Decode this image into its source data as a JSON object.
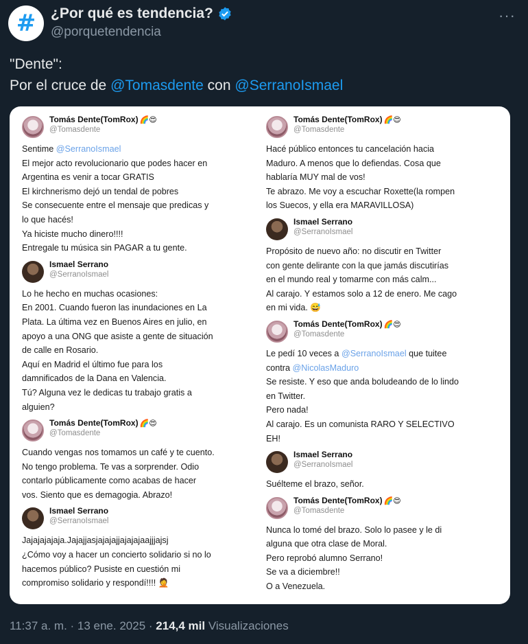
{
  "account": {
    "name": "¿Por qué es tendencia?",
    "handle": "@porquetendencia",
    "avatar_glyph": "#",
    "verified_color": "#1d9bf0"
  },
  "more_label": "···",
  "tweet": {
    "line1": "\"Dente\":",
    "line2_prefix": "Por el cruce de",
    "mention1": "@Tomasdente",
    "line2_mid": "con",
    "mention2": "@SerranoIsmael"
  },
  "embed": {
    "left": [
      {
        "author": "Tomás Dente(TomRox)",
        "emoji": "🌈😍",
        "handle": "@Tomasdente",
        "lines": [
          {
            "pre": "Sentime ",
            "mention": "@SerranoIsmael",
            "post": ""
          },
          {
            "pre": "El mejor acto revolucionario que podes hacer en"
          },
          {
            "pre": "Argentina es venir a tocar GRATIS"
          },
          {
            "pre": "El kirchnerismo dejó un tendal de pobres"
          },
          {
            "pre": "Se consecuente entre el mensaje que predicas y"
          },
          {
            "pre": "lo que hacés!"
          },
          {
            "pre": "Ya hiciste mucho dinero!!!!"
          },
          {
            "pre": "Entregale tu música sin PAGAR a tu gente."
          }
        ]
      },
      {
        "author": "Ismael Serrano",
        "emoji": "",
        "handle": "@SerranoIsmael",
        "lines": [
          {
            "pre": "Lo he hecho en muchas ocasiones:"
          },
          {
            "pre": "En 2001. Cuando fueron las inundaciones en La"
          },
          {
            "pre": "Plata. La última vez en Buenos Aires en julio, en"
          },
          {
            "pre": "apoyo a una ONG que asiste a gente de situación"
          },
          {
            "pre": "de calle en Rosario."
          },
          {
            "pre": "Aquí en Madrid el último fue para los"
          },
          {
            "pre": "damnificados de la Dana en Valencia."
          },
          {
            "pre": "Tú? Alguna vez le dedicas tu trabajo gratis a"
          },
          {
            "pre": "alguien?"
          }
        ]
      },
      {
        "author": "Tomás Dente(TomRox)",
        "emoji": "🌈😍",
        "handle": "@Tomasdente",
        "lines": [
          {
            "pre": "Cuando vengas nos tomamos un café y te cuento."
          },
          {
            "pre": "No tengo problema. Te vas a sorprender. Odio"
          },
          {
            "pre": "contarlo públicamente como acabas de hacer"
          },
          {
            "pre": "vos. Siento que es demagogia. Abrazo!"
          }
        ]
      },
      {
        "author": "Ismael Serrano",
        "emoji": "",
        "handle": "@SerranoIsmael",
        "lines": [
          {
            "pre": "Jajajajajaja.Jajajjasjajajajjajajajaajjjajsj"
          },
          {
            "pre": "¿Cómo voy a hacer un concierto solidario si no lo"
          },
          {
            "pre": "hacemos público? Pusiste en cuestión mi"
          },
          {
            "pre": "compromiso solidario y respondí!!!! 🤦"
          }
        ]
      }
    ],
    "right": [
      {
        "author": "Tomás Dente(TomRox)",
        "emoji": "🌈😍",
        "handle": "@Tomasdente",
        "lines": [
          {
            "pre": "Hacé público entonces tu cancelación hacia"
          },
          {
            "pre": "Maduro. A menos que lo defiendas. Cosa que"
          },
          {
            "pre": "hablaría MUY mal de vos!"
          },
          {
            "pre": "Te abrazo. Me voy a escuchar Roxette(la rompen"
          },
          {
            "pre": "los Suecos, y ella era MARAVILLOSA)"
          }
        ]
      },
      {
        "author": "Ismael Serrano",
        "emoji": "",
        "handle": "@SerranoIsmael",
        "lines": [
          {
            "pre": "Propósito de nuevo año: no discutir en Twitter"
          },
          {
            "pre": "con gente delirante con la que jamás discutirías"
          },
          {
            "pre": "en el mundo real y tomarme con más calm..."
          },
          {
            "pre": "Al carajo. Y estamos solo a 12 de enero. Me cago"
          },
          {
            "pre": "en mi vida. 😅"
          }
        ]
      },
      {
        "author": "Tomás Dente(TomRox)",
        "emoji": "🌈😍",
        "handle": "@Tomasdente",
        "lines": [
          {
            "pre": "Le pedí 10 veces a ",
            "mention": "@SerranoIsmael",
            "post": " que tuitee"
          },
          {
            "pre": "contra ",
            "mention": "@NicolasMaduro",
            "post": ""
          },
          {
            "pre": "Se resiste. Y eso que anda boludeando de lo lindo"
          },
          {
            "pre": "en Twitter."
          },
          {
            "pre": "Pero nada!"
          },
          {
            "pre": "Al carajo. Es un comunista RARO Y SELECTIVO"
          },
          {
            "pre": "EH!"
          }
        ]
      },
      {
        "author": "Ismael Serrano",
        "emoji": "",
        "handle": "@SerranoIsmael",
        "lines": [
          {
            "pre": "Suélteme el brazo, señor."
          }
        ]
      },
      {
        "author": "Tomás Dente(TomRox)",
        "emoji": "🌈😍",
        "handle": "@Tomasdente",
        "lines": [
          {
            "pre": "Nunca lo tomé del brazo. Solo lo pasee y le di"
          },
          {
            "pre": "alguna que otra clase de Moral."
          },
          {
            "pre": "Pero reprobó alumno Serrano!"
          },
          {
            "pre": "Se va a diciembre!!"
          },
          {
            "pre": "O a Venezuela."
          }
        ]
      }
    ]
  },
  "footer": {
    "timestamp": "11:37 a. m. · 13 ene. 2025 ·",
    "views_count": "214,4 mil",
    "views_label": "Visualizaciones"
  }
}
